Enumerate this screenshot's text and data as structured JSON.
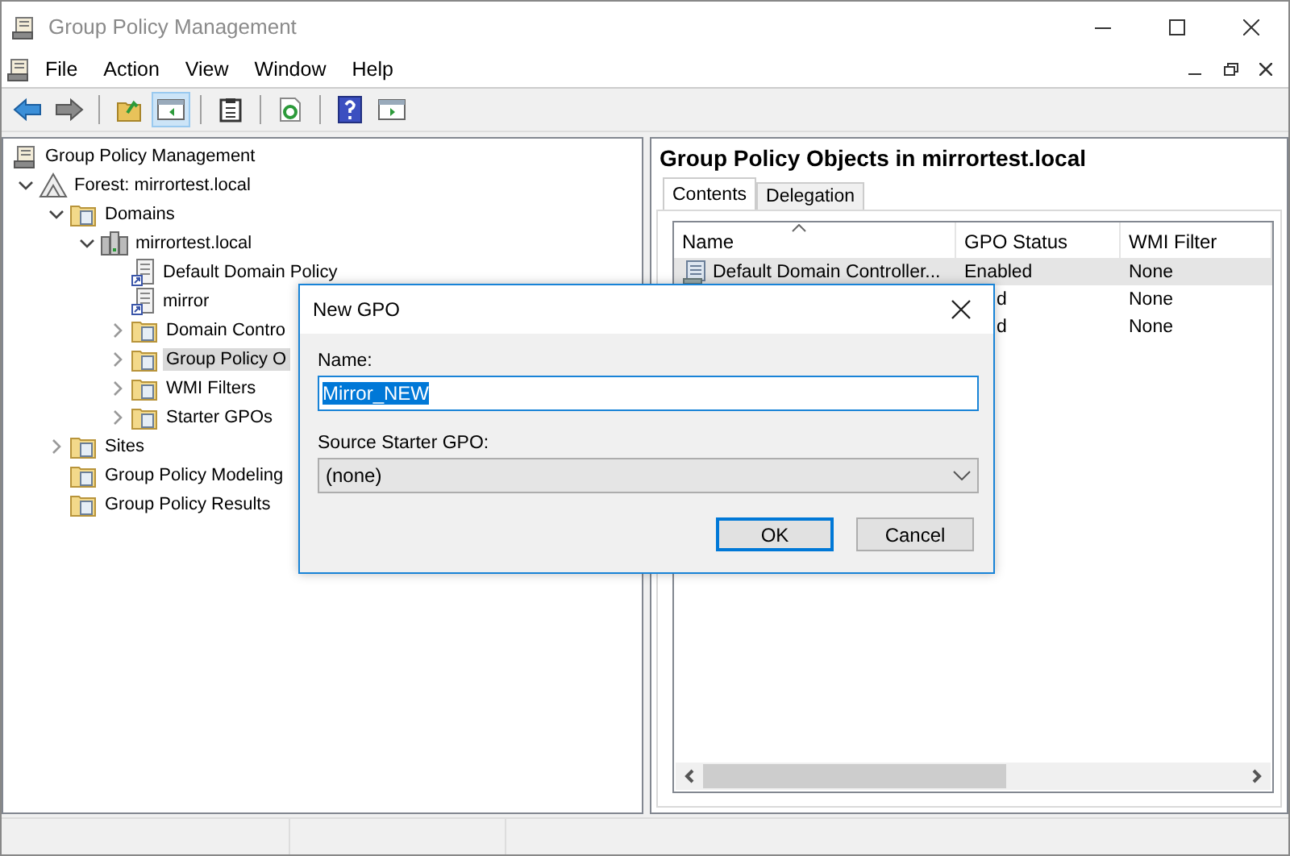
{
  "window": {
    "title": "Group Policy Management"
  },
  "menu": [
    "File",
    "Action",
    "View",
    "Window",
    "Help"
  ],
  "toolbar": [
    {
      "kind": "back",
      "on": false
    },
    {
      "kind": "forward",
      "on": false
    },
    {
      "kind": "sep"
    },
    {
      "kind": "folder-up",
      "on": false
    },
    {
      "kind": "console-tree",
      "on": true
    },
    {
      "kind": "sep"
    },
    {
      "kind": "clipboard",
      "on": false
    },
    {
      "kind": "sep"
    },
    {
      "kind": "refresh",
      "on": false
    },
    {
      "kind": "sep"
    },
    {
      "kind": "help",
      "on": false
    },
    {
      "kind": "action-pane",
      "on": false
    }
  ],
  "tree": [
    {
      "label": "Group Policy Management",
      "kind": "scroll",
      "selected": false,
      "children": [
        {
          "label": "Forest: mirrortest.local",
          "kind": "forest",
          "expanded": true,
          "selected": false,
          "children": [
            {
              "label": "Domains",
              "kind": "folder",
              "expanded": true,
              "selected": false,
              "children": [
                {
                  "label": "mirrortest.local",
                  "kind": "domain",
                  "expanded": true,
                  "selected": false,
                  "children": [
                    {
                      "label": "Default Domain Policy",
                      "kind": "link",
                      "selected": false
                    },
                    {
                      "label": "mirror",
                      "kind": "link",
                      "selected": false
                    },
                    {
                      "label": "Domain Contro",
                      "kind": "folder",
                      "expanded": false,
                      "selected": false
                    },
                    {
                      "label": "Group Policy O",
                      "kind": "folder",
                      "expanded": false,
                      "selected": true
                    },
                    {
                      "label": "WMI Filters",
                      "kind": "folder",
                      "expanded": false,
                      "selected": false
                    },
                    {
                      "label": "Starter GPOs",
                      "kind": "folder",
                      "expanded": false,
                      "selected": false
                    }
                  ]
                }
              ]
            },
            {
              "label": "Sites",
              "kind": "folder",
              "expanded": false,
              "selected": false
            },
            {
              "label": "Group Policy Modeling",
              "kind": "folder",
              "selected": false
            },
            {
              "label": "Group Policy Results",
              "kind": "folder",
              "selected": false
            }
          ]
        }
      ]
    }
  ],
  "details": {
    "title": "Group Policy Objects in mirrortest.local",
    "tabs": [
      {
        "label": "Contents",
        "selected": true
      },
      {
        "label": "Delegation",
        "selected": false
      }
    ],
    "columns": [
      "Name",
      "GPO Status",
      "WMI Filter"
    ],
    "rows": [
      {
        "name": "Default Domain Controller...",
        "status": "Enabled",
        "wmi_filter": "None",
        "selected": true
      },
      {
        "status": "d",
        "wmi_filter": "None",
        "selected": false
      },
      {
        "status": "d",
        "wmi_filter": "None",
        "selected": false
      }
    ]
  },
  "dialog": {
    "title": "New GPO",
    "name_label": "Name:",
    "name_value": "Mirror_NEW",
    "source_label": "Source Starter GPO:",
    "source_value": "(none)",
    "buttons": [
      {
        "label": "OK",
        "default": true
      },
      {
        "label": "Cancel",
        "default": false
      }
    ]
  }
}
